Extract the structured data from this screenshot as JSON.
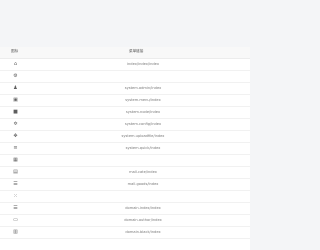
{
  "table": {
    "headers": [
      "图标",
      "菜单链接"
    ],
    "rows": [
      {
        "icon": "home-icon",
        "glyph": "⌂",
        "path": "index/index/index"
      },
      {
        "icon": "gear-icon",
        "glyph": "⚙",
        "path": ""
      },
      {
        "icon": "user-icon",
        "glyph": "♟",
        "path": "system.admin/index"
      },
      {
        "icon": "menu-icon",
        "glyph": "▣",
        "path": "system.menu/index"
      },
      {
        "icon": "role-icon",
        "glyph": "■",
        "path": "system.node/index"
      },
      {
        "icon": "config-icon",
        "glyph": "✲",
        "path": "system.config/index"
      },
      {
        "icon": "upload-icon",
        "glyph": "✥",
        "path": "system.uploadfile/index"
      },
      {
        "icon": "quick-icon",
        "glyph": "≡",
        "path": "system.quick/index"
      },
      {
        "icon": "grid-icon",
        "glyph": "▦",
        "path": ""
      },
      {
        "icon": "calendar-icon",
        "glyph": "▤",
        "path": "mall.cate/index"
      },
      {
        "icon": "list-icon",
        "glyph": "☰",
        "path": "mall.goods/index"
      },
      {
        "icon": "apps-icon",
        "glyph": "⁙",
        "path": ""
      },
      {
        "icon": "list-icon",
        "glyph": "☰",
        "path": "domain.index/index"
      },
      {
        "icon": "card-icon",
        "glyph": "▭",
        "path": "domain.author/index"
      },
      {
        "icon": "table-icon",
        "glyph": "▥",
        "path": "domain.black/index"
      }
    ]
  }
}
